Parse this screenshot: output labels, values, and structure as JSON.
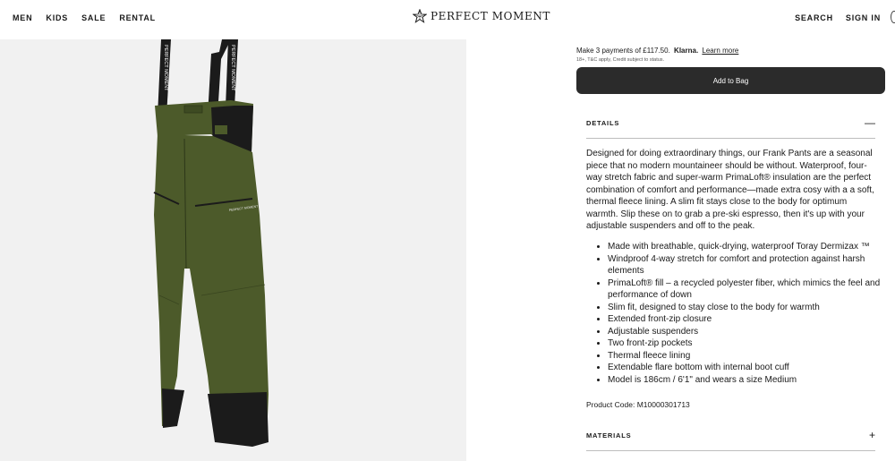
{
  "header": {
    "nav_left": [
      "MEN",
      "KIDS",
      "SALE",
      "RENTAL"
    ],
    "logo_text": "PERFECT MOMENT",
    "nav_right": [
      "SEARCH",
      "SIGN IN"
    ]
  },
  "product_image": {
    "strap_text": "PERFECT MOMENT",
    "pocket_label": "PERFECT MOMENT",
    "colors": {
      "pant": "#4c5a2a",
      "panel": "#1b1b1b",
      "background": "#f1f1f1"
    }
  },
  "payment": {
    "klarna_prefix": "Make 3 payments of £117.50.",
    "klarna_logo": "Klarna.",
    "learn_more": "Learn more",
    "terms": "18+, T&C apply, Credit subject to status."
  },
  "add_to_bag_label": "Add to Bag",
  "details": {
    "label": "DETAILS",
    "toggle_icon": "minus-icon",
    "description": "Designed for doing extraordinary things, our Frank Pants are a seasonal piece that no modern mountaineer should be without. Waterproof, four-way stretch fabric and super-warm PrimaLoft® insulation are the perfect combination of comfort and performance—made extra cosy with a a soft, thermal fleece lining. A slim fit stays close to the body for optimum warmth. Slip these on to grab a pre-ski espresso, then it's up with your adjustable suspenders and off to the peak.",
    "features": [
      "Made with breathable, quick-drying, waterproof Toray Dermizax ™",
      "Windproof 4-way stretch for comfort and protection against harsh elements",
      "PrimaLoft® fill – a recycled polyester fiber, which mimics the feel and performance of down",
      "Slim fit, designed to stay close to the body for warmth",
      "Extended front-zip closure",
      "Adjustable suspenders",
      "Two front-zip pockets",
      "Thermal fleece lining",
      "Extendable flare bottom with internal boot cuff",
      "Model is 186cm / 6'1\" and wears a size Medium"
    ],
    "product_code": "Product Code: M10000301713"
  },
  "materials": {
    "label": "MATERIALS",
    "toggle_icon": "plus-icon"
  }
}
